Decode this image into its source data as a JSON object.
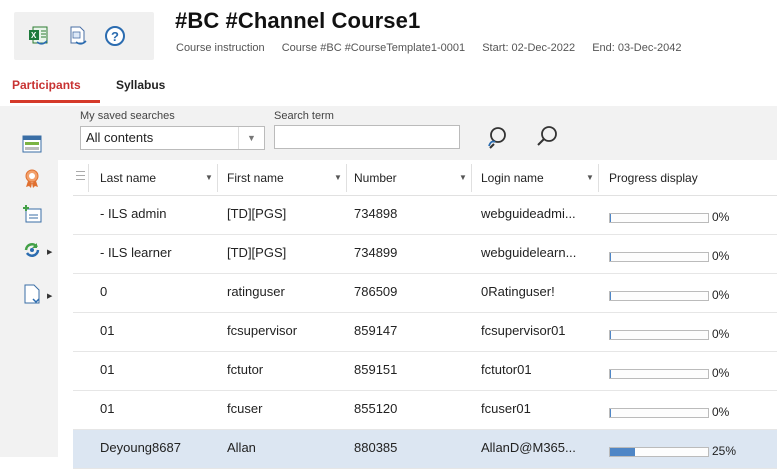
{
  "header": {
    "title": "#BC #Channel Course1",
    "meta": {
      "type": "Course instruction",
      "course": "Course #BC #CourseTemplate1-0001",
      "start": "Start: 02-Dec-2022",
      "end": "End: 03-Dec-2042"
    },
    "icons": [
      "excel-export-icon",
      "document-export-icon",
      "help-icon"
    ]
  },
  "tabs": [
    {
      "label": "Participants",
      "active": true
    },
    {
      "label": "Syllabus",
      "active": false
    }
  ],
  "tools": [
    "list-view-icon",
    "certificate-icon",
    "add-participant-icon",
    "sync-icon",
    "document-icon"
  ],
  "search": {
    "saved_label": "My saved searches",
    "saved_value": "All contents",
    "term_label": "Search term",
    "term_value": ""
  },
  "table": {
    "columns": [
      "Last name",
      "First name",
      "Number",
      "Login name",
      "Progress display"
    ],
    "rows": [
      {
        "last": "- ILS admin",
        "first": "[TD][PGS]",
        "number": "734898",
        "login": "webguideadmi...",
        "progress": 0,
        "progress_label": "0%"
      },
      {
        "last": "- ILS learner",
        "first": "[TD][PGS]",
        "number": "734899",
        "login": "webguidelearn...",
        "progress": 0,
        "progress_label": "0%"
      },
      {
        "last": "0",
        "first": "ratinguser",
        "number": "786509",
        "login": "0Ratinguser!",
        "progress": 0,
        "progress_label": "0%"
      },
      {
        "last": "01",
        "first": "fcsupervisor",
        "number": "859147",
        "login": "fcsupervisor01",
        "progress": 0,
        "progress_label": "0%"
      },
      {
        "last": "01",
        "first": "fctutor",
        "number": "859151",
        "login": "fctutor01",
        "progress": 0,
        "progress_label": "0%"
      },
      {
        "last": "01",
        "first": "fcuser",
        "number": "855120",
        "login": "fcuser01",
        "progress": 0,
        "progress_label": "0%"
      },
      {
        "last": "Deyoung8687",
        "first": "Allan",
        "number": "880385",
        "login": "AllanD@M365...",
        "progress": 25,
        "progress_label": "25%",
        "selected": true
      }
    ]
  },
  "colors": {
    "accent": "#d53a2a",
    "progress": "#4f86c6",
    "selected_row": "#dce6f2"
  }
}
